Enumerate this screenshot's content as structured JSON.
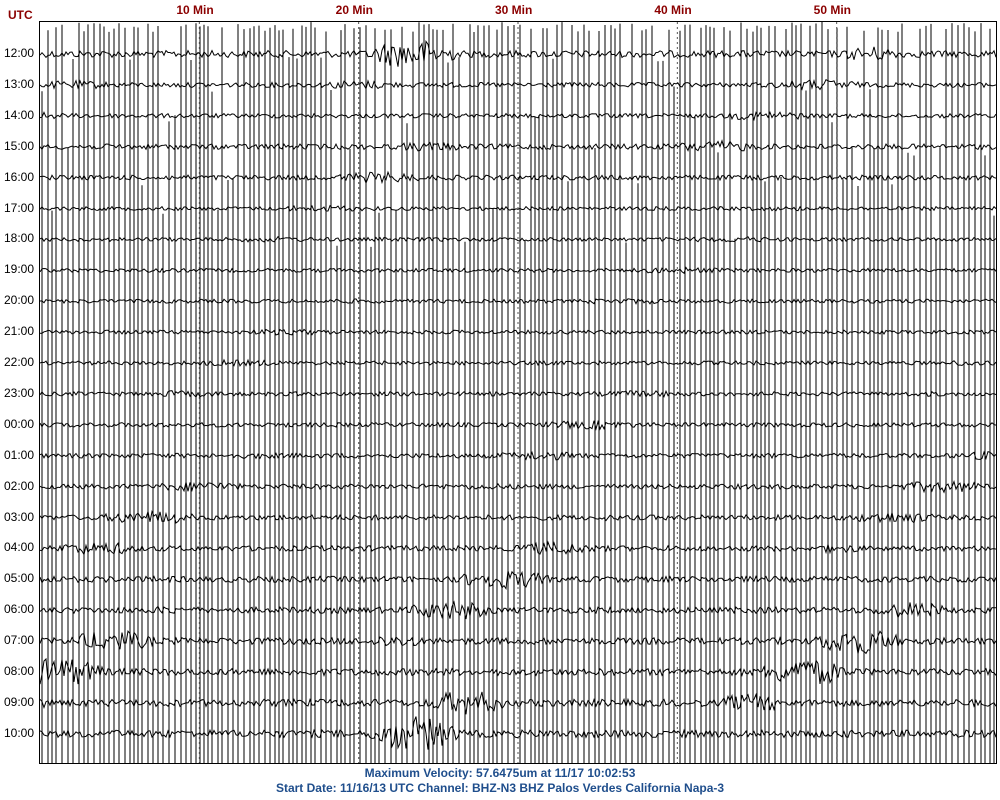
{
  "chart_data": {
    "type": "line",
    "title": "",
    "time_zone_label": "UTC",
    "x_axis": {
      "unit": "minutes",
      "range": [
        0,
        60
      ],
      "tick_labels": [
        "10 Min",
        "20 Min",
        "30 Min",
        "40 Min",
        "50 Min"
      ],
      "tick_values": [
        10,
        20,
        30,
        40,
        50
      ]
    },
    "hour_labels": [
      "12:00",
      "13:00",
      "14:00",
      "15:00",
      "16:00",
      "17:00",
      "18:00",
      "19:00",
      "20:00",
      "21:00",
      "22:00",
      "23:00",
      "00:00",
      "01:00",
      "02:00",
      "03:00",
      "04:00",
      "05:00",
      "06:00",
      "07:00",
      "08:00",
      "09:00",
      "10:00"
    ],
    "series_color": "#000000",
    "label_color": "#8b0000",
    "footer_color": "#1f4e8c",
    "trace_activity": [
      0.9,
      0.5,
      0.4,
      0.6,
      0.5,
      0.3,
      0.3,
      0.3,
      0.3,
      0.3,
      0.3,
      0.35,
      0.4,
      0.45,
      0.5,
      0.55,
      0.6,
      0.7,
      0.75,
      0.85,
      0.9,
      0.95,
      1.0
    ]
  },
  "footer": {
    "line1": "Maximum Velocity: 57.6475um at 11/17 10:02:53",
    "line2": "Start Date: 11/16/13 UTC Channel: BHZ-N3  BHZ  Palos Verdes California  Napa-3"
  }
}
